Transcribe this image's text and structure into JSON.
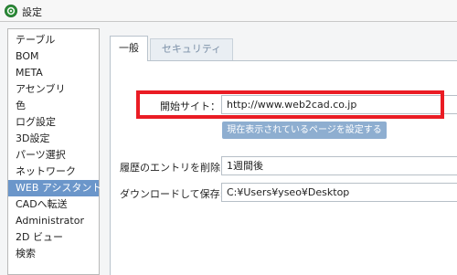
{
  "window": {
    "title": "設定"
  },
  "sidebar": {
    "items": [
      {
        "label": "テーブル"
      },
      {
        "label": "BOM"
      },
      {
        "label": "META"
      },
      {
        "label": "アセンブリ"
      },
      {
        "label": "色"
      },
      {
        "label": "ログ設定"
      },
      {
        "label": "3D設定"
      },
      {
        "label": "パーツ選択"
      },
      {
        "label": "ネットワーク"
      },
      {
        "label": "WEB アシスタント"
      },
      {
        "label": "CADへ転送"
      },
      {
        "label": "Administrator"
      },
      {
        "label": "2D ビュー"
      },
      {
        "label": "検索"
      }
    ],
    "selected": "WEB アシスタント"
  },
  "tabs": [
    {
      "label": "一般",
      "active": true
    },
    {
      "label": "セキュリティ",
      "active": false
    }
  ],
  "form": {
    "start_site": {
      "label": "開始サイト：",
      "value": "http://www.web2cad.co.jp"
    },
    "set_current_page_button": "現在表示されているページを設定する",
    "history_delete": {
      "label": "履歴のエントリを削除:",
      "value": "1週間後"
    },
    "download_save": {
      "label": "ダウンロードして保存:",
      "value": "C:¥Users¥yseo¥Desktop"
    }
  },
  "colors": {
    "selection": "#6b96ca",
    "highlight_box": "#ea1c24",
    "button": "#8eaed0",
    "app_icon": "#2f8f3a"
  },
  "icons": {
    "app": "app-icon"
  }
}
